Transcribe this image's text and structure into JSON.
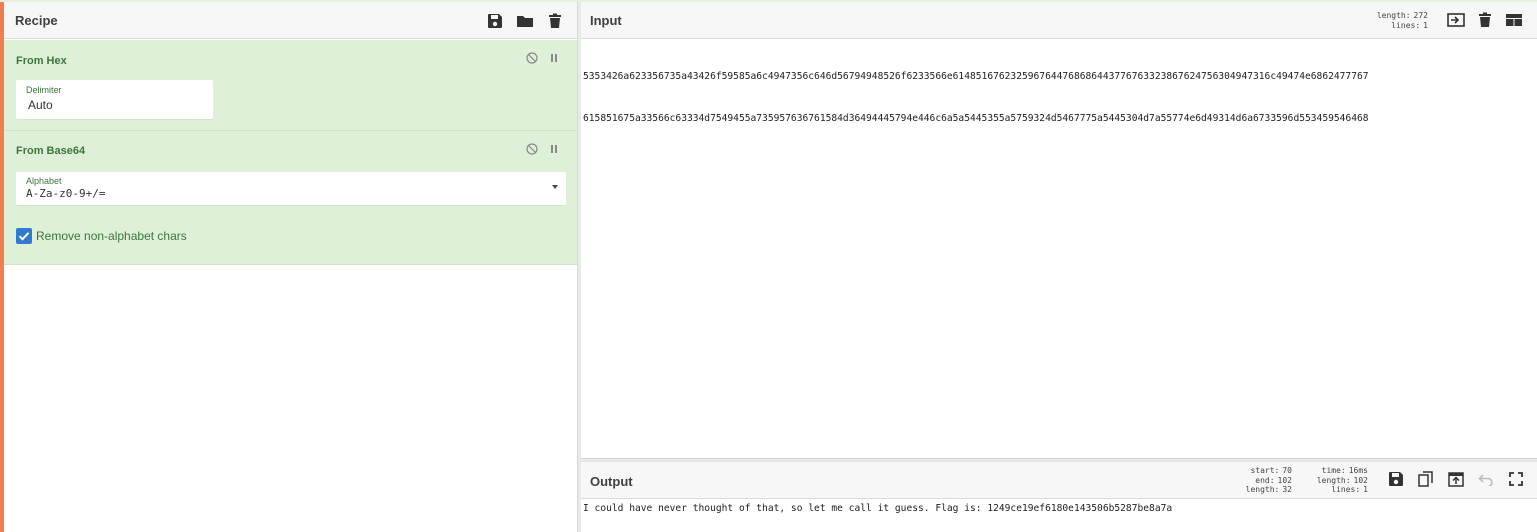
{
  "recipe": {
    "title": "Recipe",
    "operations": [
      {
        "name": "From Hex",
        "args": {
          "delimiter_label": "Delimiter",
          "delimiter_value": "Auto"
        }
      },
      {
        "name": "From Base64",
        "args": {
          "alphabet_label": "Alphabet",
          "alphabet_value": "A-Za-z0-9+/=",
          "remove_label": "Remove non-alphabet chars",
          "remove_checked": true
        }
      }
    ],
    "icons": [
      "save-icon",
      "folder-icon",
      "trash-icon"
    ]
  },
  "input": {
    "title": "Input",
    "stats": {
      "length_label": "length:",
      "length": "272",
      "lines_label": "lines:",
      "lines": "1"
    },
    "line1": "5353426a623356735a43426f59585a6c4947356c646d56794948526f6233566e614851676232596764476868644377676332386762475630494731​6c49474e6862477767",
    "line2": "615851675a33566c63334d7549455a735957636761584d36494445794e446c6a5a5445355a5759324d5467775a5445304d7a55774e6d49314d6a6733596d553459546468"
  },
  "output": {
    "title": "Output",
    "stats": {
      "start_label": "start:",
      "start": "70",
      "end_label": "end:",
      "end": "102",
      "length_label": "length:",
      "length": "32",
      "time_label": "time:",
      "time": "16ms",
      "out_length_label": "length:",
      "out_length": "102",
      "lines_label": "lines:",
      "lines": "1"
    },
    "text": "I could have never thought of that, so let me call it guess. Flag is: 1249ce19ef6180e143506b5287be8a7a"
  },
  "colors": {
    "accent": "#f07e4f",
    "op_bg": "#dff0d8",
    "op_text": "#3c763d",
    "checkbox": "#2f7bcf"
  }
}
